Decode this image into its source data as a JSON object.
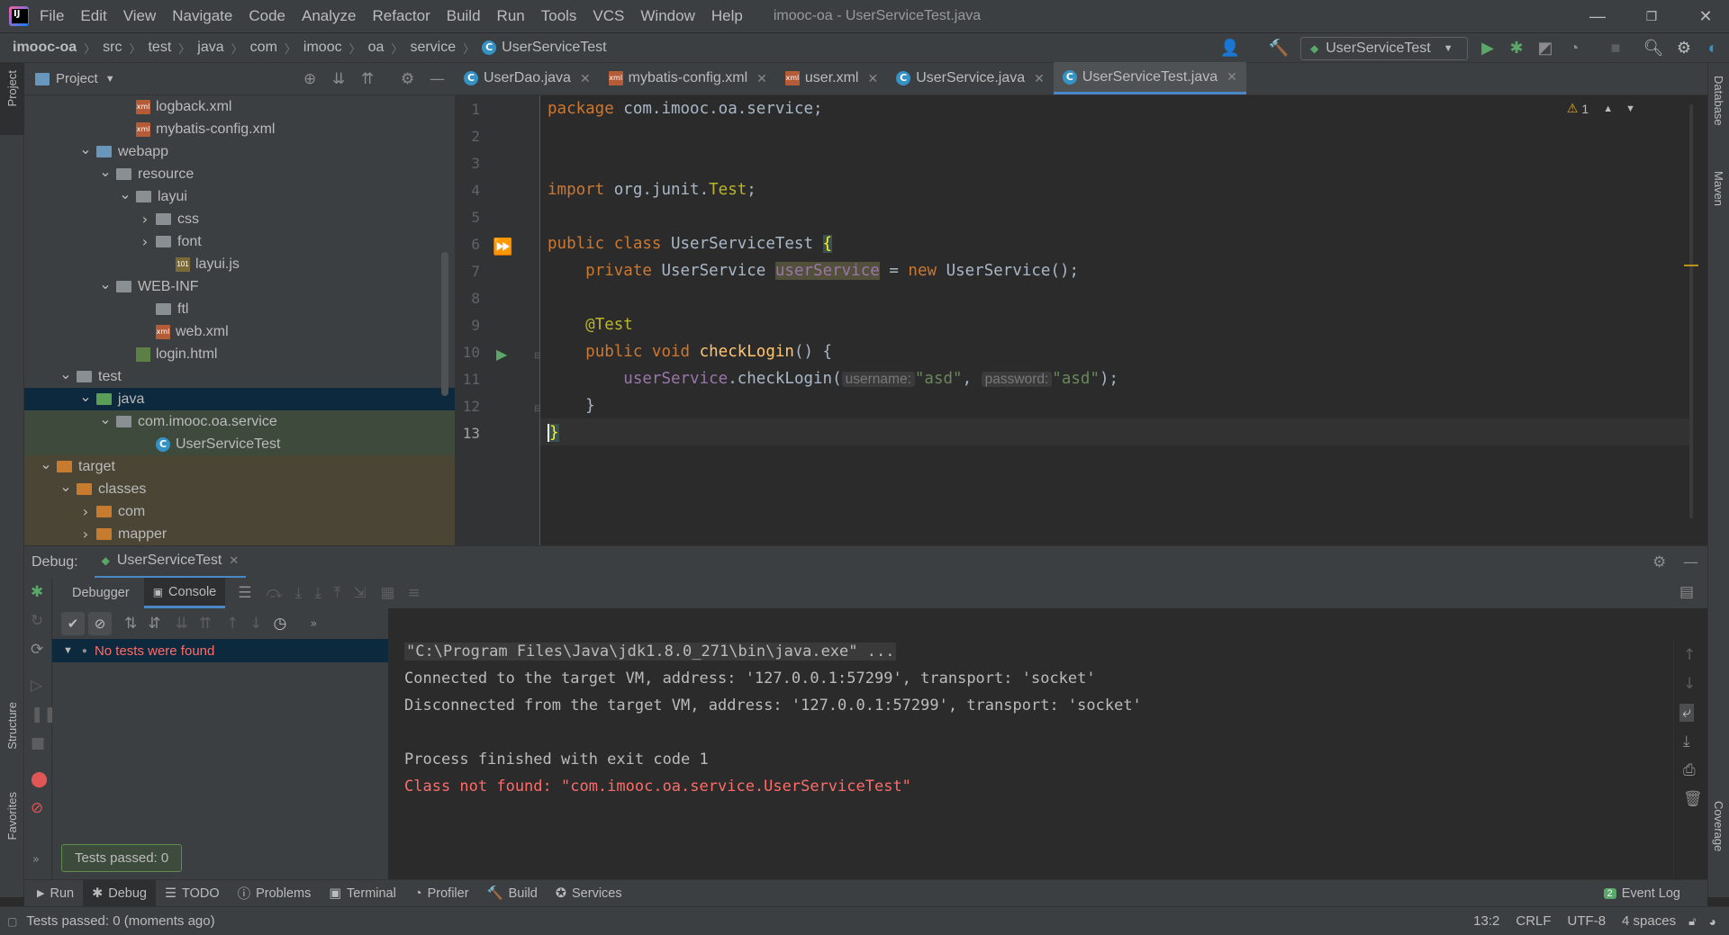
{
  "menu": {
    "items": [
      "File",
      "Edit",
      "View",
      "Navigate",
      "Code",
      "Analyze",
      "Refactor",
      "Build",
      "Run",
      "Tools",
      "VCS",
      "Window",
      "Help"
    ],
    "window_title": "imooc-oa - UserServiceTest.java"
  },
  "breadcrumb": [
    "imooc-oa",
    "src",
    "test",
    "java",
    "com",
    "imooc",
    "oa",
    "service",
    "UserServiceTest"
  ],
  "run_config": "UserServiceTest",
  "project_panel": {
    "title": "Project",
    "tree": [
      {
        "label": "logback.xml",
        "icon": "xml-file-icon",
        "indent": 5
      },
      {
        "label": "mybatis-config.xml",
        "icon": "xml-file-icon",
        "indent": 5
      },
      {
        "label": "webapp",
        "icon": "web-folder-icon",
        "indent": 3,
        "arrow": "open"
      },
      {
        "label": "resource",
        "icon": "folder-icon",
        "indent": 4,
        "arrow": "open"
      },
      {
        "label": "layui",
        "icon": "folder-icon",
        "indent": 5,
        "arrow": "open"
      },
      {
        "label": "css",
        "icon": "folder-icon",
        "indent": 6,
        "arrow": "closed"
      },
      {
        "label": "font",
        "icon": "folder-icon",
        "indent": 6,
        "arrow": "closed"
      },
      {
        "label": "layui.js",
        "icon": "js-file-icon",
        "indent": 7
      },
      {
        "label": "WEB-INF",
        "icon": "folder-icon",
        "indent": 4,
        "arrow": "open"
      },
      {
        "label": "ftl",
        "icon": "folder-icon",
        "indent": 6
      },
      {
        "label": "web.xml",
        "icon": "xml-file-icon",
        "indent": 6
      },
      {
        "label": "login.html",
        "icon": "html-file-icon",
        "indent": 5
      },
      {
        "label": "test",
        "icon": "folder-icon",
        "indent": 2,
        "arrow": "open"
      },
      {
        "label": "java",
        "icon": "test-folder-icon",
        "indent": 3,
        "arrow": "open",
        "state": "selected"
      },
      {
        "label": "com.imooc.oa.service",
        "icon": "package-icon",
        "indent": 4,
        "arrow": "open",
        "state": "pkg"
      },
      {
        "label": "UserServiceTest",
        "icon": "class-icon",
        "indent": 6,
        "state": "pkg"
      },
      {
        "label": "target",
        "icon": "excluded-folder-icon",
        "indent": 1,
        "arrow": "open",
        "state": "tgt"
      },
      {
        "label": "classes",
        "icon": "excluded-folder-icon",
        "indent": 2,
        "arrow": "open",
        "state": "tgt"
      },
      {
        "label": "com",
        "icon": "excluded-folder-icon",
        "indent": 3,
        "arrow": "closed",
        "state": "tgt"
      },
      {
        "label": "mapper",
        "icon": "excluded-folder-icon",
        "indent": 3,
        "arrow": "closed",
        "state": "tgt"
      }
    ]
  },
  "editor_tabs": [
    {
      "label": "UserDao.java",
      "icon": "class-icon"
    },
    {
      "label": "mybatis-config.xml",
      "icon": "xml-file-icon"
    },
    {
      "label": "user.xml",
      "icon": "xml-file-icon"
    },
    {
      "label": "UserService.java",
      "icon": "class-icon"
    },
    {
      "label": "UserServiceTest.java",
      "icon": "class-icon",
      "active": true
    }
  ],
  "editor": {
    "warning_count": "1",
    "line_numbers": [
      "1",
      "2",
      "3",
      "4",
      "5",
      "6",
      "7",
      "8",
      "9",
      "10",
      "11",
      "12",
      "13"
    ],
    "code": {
      "l1_kw": "package ",
      "l1_rest": "com.imooc.oa.service;",
      "l4_kw": "import ",
      "l4_rest": "org.junit.",
      "l4_ann": "Test",
      "l4_end": ";",
      "l6_kw": "public class ",
      "l6_name": "UserServiceTest ",
      "l6_brace": "{",
      "l7_kw": "private ",
      "l7_type": "UserService ",
      "l7_field": "userService",
      "l7_eq": " = ",
      "l7_new": "new ",
      "l7_rest": "UserService();",
      "l9_ann": "@Test",
      "l10_kw": "public void ",
      "l10_fn": "checkLogin",
      "l10_rest": "() {",
      "l11_field": "userService",
      "l11_call": ".checkLogin(",
      "l11_hint1": "username:",
      "l11_s1": "\"asd\"",
      "l11_comma": ", ",
      "l11_hint2": "password:",
      "l11_s2": "\"asd\"",
      "l11_end": ");",
      "l12": "}",
      "l13": "}"
    }
  },
  "debug": {
    "label": "Debug:",
    "session_tab": "UserServiceTest",
    "tabs": {
      "debugger": "Debugger",
      "console": "Console"
    },
    "test_status": "No tests were found",
    "tooltip": "Tests passed: 0",
    "console_lines": [
      {
        "text": "\"C:\\Program Files\\Java\\jdk1.8.0_271\\bin\\java.exe\" ...",
        "color": "#bbbbbb",
        "boxed": true
      },
      {
        "text": "Connected to the target VM, address: '127.0.0.1:57299', transport: 'socket'",
        "color": "#bbbbbb"
      },
      {
        "text": "Disconnected from the target VM, address: '127.0.0.1:57299', transport: 'socket'",
        "color": "#bbbbbb"
      },
      {
        "text": "",
        "color": "#bbbbbb"
      },
      {
        "text": "Process finished with exit code 1",
        "color": "#bbbbbb"
      },
      {
        "text": "Class not found: \"com.imooc.oa.service.UserServiceTest\"",
        "color": "#ff6b68"
      }
    ]
  },
  "bottom_tools": {
    "run": "Run",
    "debug": "Debug",
    "todo": "TODO",
    "problems": "Problems",
    "terminal": "Terminal",
    "profiler": "Profiler",
    "build": "Build",
    "services": "Services",
    "event_log": "Event Log",
    "event_count": "2"
  },
  "status": {
    "message": "Tests passed: 0 (moments ago)",
    "position": "13:2",
    "line_sep": "CRLF",
    "encoding": "UTF-8",
    "indent": "4 spaces"
  },
  "side_labels": {
    "project": "Project",
    "structure": "Structure",
    "favorites": "Favorites",
    "database": "Database",
    "maven": "Maven",
    "coverage": "Coverage"
  }
}
